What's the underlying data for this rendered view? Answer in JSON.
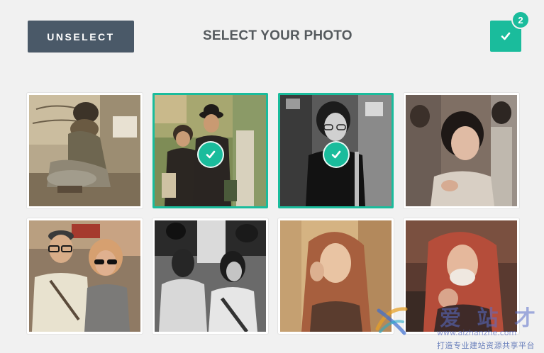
{
  "header": {
    "unselect_label": "UNSELECT",
    "title": "SELECT YOUR PHOTO",
    "confirm_icon": "check-icon",
    "selected_count": "2"
  },
  "colors": {
    "accent": "#1abc9c",
    "unselect_button": "#4a5968",
    "title_text": "#555a5e",
    "background": "#f1f1f1"
  },
  "photos": [
    {
      "subject": "person-crouching-hat",
      "tone": "sepia",
      "selected": false
    },
    {
      "subject": "two-men-street",
      "tone": "warm-color",
      "selected": true
    },
    {
      "subject": "woman-glasses",
      "tone": "black-white",
      "selected": true
    },
    {
      "subject": "woman-short-hair",
      "tone": "muted-color",
      "selected": false
    },
    {
      "subject": "couple-sunglasses",
      "tone": "warm-color",
      "selected": false
    },
    {
      "subject": "two-women-talking",
      "tone": "black-white",
      "selected": false
    },
    {
      "subject": "woman-red-hair",
      "tone": "golden",
      "selected": false
    },
    {
      "subject": "woman-face-mask",
      "tone": "reddish",
      "selected": false
    }
  ],
  "watermark": {
    "title": "爱 站 才",
    "url": "www.aizhanzhe.com",
    "tagline": "打造专业建站资源共享平台"
  }
}
